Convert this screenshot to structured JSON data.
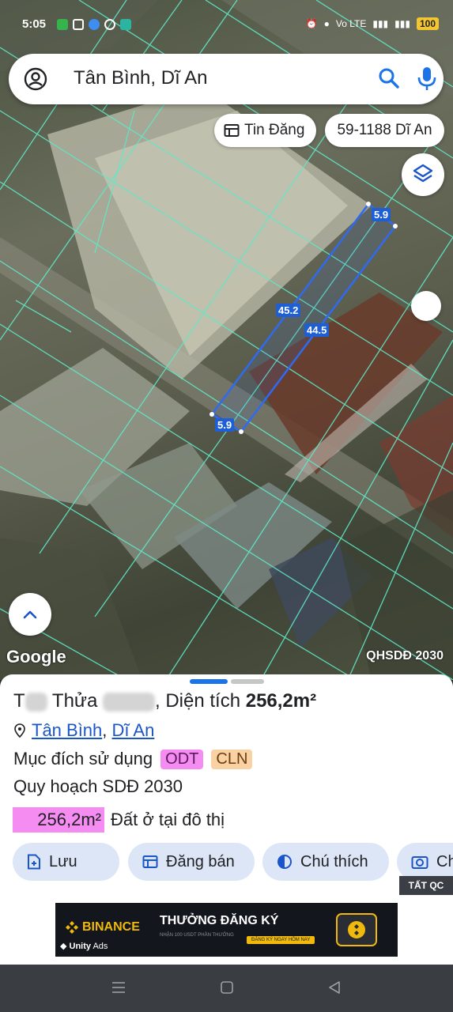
{
  "status_bar": {
    "time": "5:05",
    "network_label": "Vo LTE",
    "battery": "100"
  },
  "search": {
    "query": "Tân Bình, Dĩ An",
    "icons": [
      "account-icon",
      "search-icon",
      "mic-icon"
    ]
  },
  "chips": {
    "listing_label": "Tin Đăng",
    "lot_label": "59-1188 Dĩ An"
  },
  "map": {
    "dimensions": [
      "5.9",
      "45.2",
      "44.5",
      "5.9"
    ],
    "attribution": "Google",
    "plan_layer": "QHSDĐ 2030",
    "colors": {
      "parcel_lines": "#5fe8c8",
      "selection": "#2f6bf0",
      "label_bg": "#1f5fd6"
    }
  },
  "sheet": {
    "title_prefix": "T",
    "title_mid": " Thửa",
    "title_suffix": ", Diện tích ",
    "title_area": "256,2m²",
    "location_ward": "Tân Bình",
    "location_sep": ",",
    "location_city": "Dĩ An",
    "purpose_label": "Mục đích sử dụng",
    "tags": [
      "ODT",
      "CLN"
    ],
    "plan_label": "Quy hoạch SDĐ 2030",
    "area_value": "256,2m²",
    "area_desc": "Đất ở tại đô thị",
    "actions": [
      "Lưu",
      "Đăng bán",
      "Chú thích",
      "Ch"
    ],
    "hide_ads": "TẤT QC",
    "colors": {
      "accent": "#1a73e8",
      "odt": "#f48cf2",
      "cln": "#f9d1a3",
      "action_bg": "#dde6f7"
    }
  },
  "ad": {
    "brand": "BINANCE",
    "network": "Unity",
    "network_suffix": "Ads",
    "headline": "THƯỞNG ĐĂNG KÝ",
    "subtext": "NHẬN 100 USDT PHẦN THƯỞNG",
    "cta": "ĐĂNG KÝ NGAY HÔM NAY"
  }
}
